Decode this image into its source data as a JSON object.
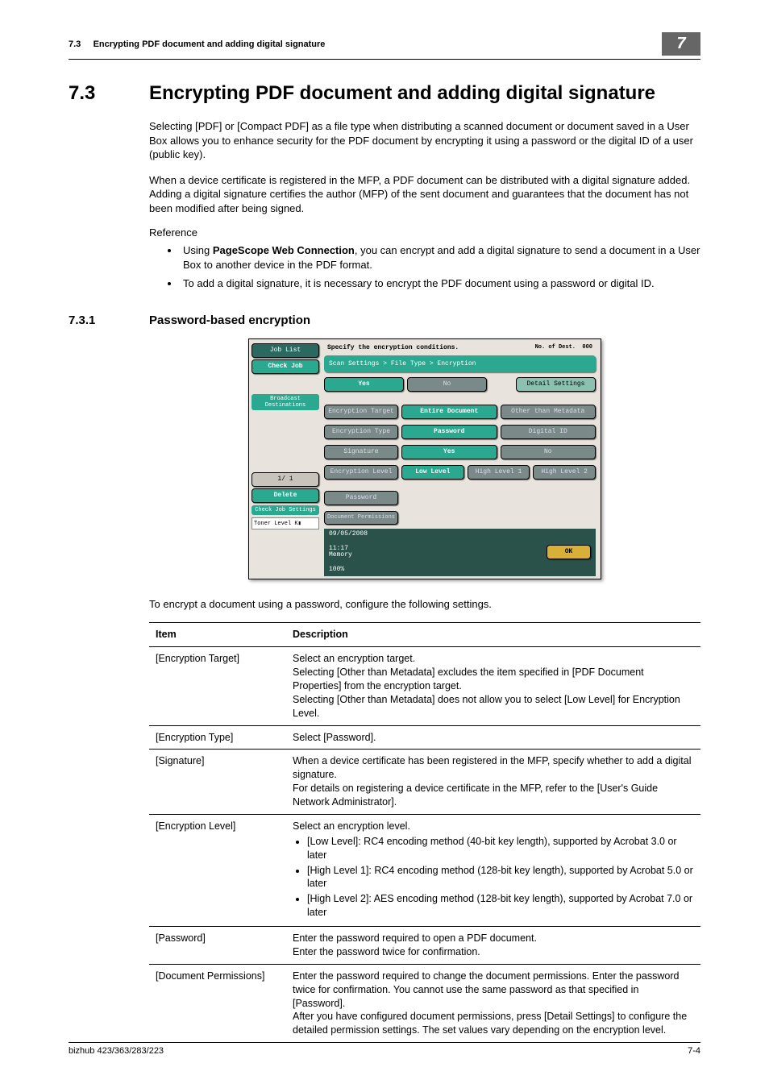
{
  "header": {
    "sect_no": "7.3",
    "sect_title": "Encrypting PDF document and adding digital signature",
    "chapter": "7"
  },
  "section": {
    "num": "7.3",
    "title": "Encrypting PDF document and adding digital signature",
    "p1": "Selecting [PDF] or [Compact PDF] as a file type when distributing a scanned document or document saved in a User Box allows you to enhance security for the PDF document by encrypting it using a password or the digital ID of a user (public key).",
    "p2": "When a device certificate is registered in the MFP, a PDF document can be distributed with a digital signature added. Adding a digital signature certifies the author (MFP) of the sent document and guarantees that the document has not been modified after being signed.",
    "ref_label": "Reference",
    "ref1a": "Using ",
    "ref1b": "PageScope Web Connection",
    "ref1c": ", you can encrypt and add a digital signature to send a document in a User Box to another device in the PDF format.",
    "ref2": "To add a digital signature, it is necessary to encrypt the PDF document using a password or digital ID."
  },
  "subsection": {
    "num": "7.3.1",
    "title": "Password-based encryption"
  },
  "panel": {
    "job_list": "Job List",
    "check_job": "Check Job",
    "bc_dest": "Broadcast Destinations",
    "pager": "1/  1",
    "delete": "Delete",
    "check_job_settings": "Check Job Settings",
    "toner": "Toner Level  K",
    "instr": "Specify the encryption conditions.",
    "dest_no": "No. of Dest.",
    "dest_count": "000",
    "breadcrumb": "Scan Settings > File Type > Encryption",
    "yes": "Yes",
    "no": "No",
    "detail": "Detail Settings",
    "enc_target": "Encryption Target",
    "entire_doc": "Entire Document",
    "other_meta": "Other than Metadata",
    "enc_type": "Encryption Type",
    "password": "Password",
    "digital_id": "Digital ID",
    "signature": "Signature",
    "enc_level": "Encryption Level",
    "low": "Low Level",
    "hi1": "High Level 1",
    "hi2": "High Level 2",
    "pw_btn": "Password",
    "doc_perm": "Document Permissions",
    "date": "09/05/2008",
    "time": "11:17",
    "mem": "Memory",
    "mem_pct": "100%",
    "ok": "OK"
  },
  "after_panel": "To encrypt a document using a password, configure the following settings.",
  "table": {
    "h1": "Item",
    "h2": "Description",
    "r1_item": "[Encryption Target]",
    "r1_desc": "Select an encryption target.\nSelecting [Other than Metadata] excludes the item specified in [PDF Document Properties] from the encryption target.\nSelecting [Other than Metadata] does not allow you to select [Low Level] for Encryption Level.",
    "r2_item": "[Encryption Type]",
    "r2_desc": "Select [Password].",
    "r3_item": "[Signature]",
    "r3_desc": "When a device certificate has been registered in the MFP, specify whether to add a digital signature.\nFor details on registering a device certificate in the MFP, refer to the [User's Guide Network Administrator].",
    "r4_item": "[Encryption Level]",
    "r4_intro": "Select an encryption level.",
    "r4_b1": "[Low Level]: RC4 encoding method (40-bit key length), supported by Acrobat 3.0 or later",
    "r4_b2": "[High Level 1]: RC4 encoding method (128-bit key length), supported by Acrobat 5.0 or later",
    "r4_b3": "[High Level 2]: AES encoding method (128-bit key length), supported by Acrobat 7.0 or later",
    "r5_item": "[Password]",
    "r5_desc": "Enter the password required to open a PDF document.\nEnter the password twice for confirmation.",
    "r6_item": "[Document Permissions]",
    "r6_desc": "Enter the password required to change the document permissions. Enter the password twice for confirmation. You cannot use the same password as that specified in [Password].\nAfter you have configured document permissions, press [Detail Settings] to configure the detailed permission settings. The set values vary depending on the encryption level."
  },
  "footer": {
    "model": "bizhub 423/363/283/223",
    "page": "7-4"
  }
}
